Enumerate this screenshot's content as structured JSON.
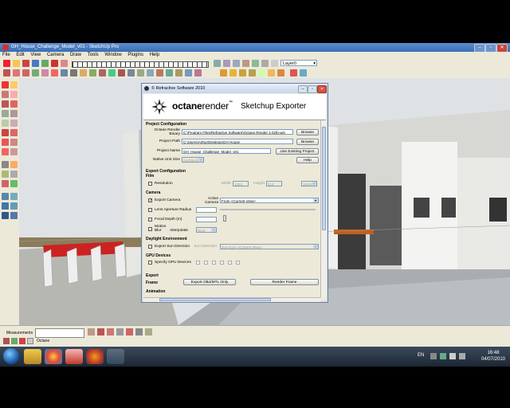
{
  "window": {
    "title": "GH_House_Challenge_Model_v01 - SketchUp Pro"
  },
  "menu": [
    "File",
    "Edit",
    "View",
    "Camera",
    "Draw",
    "Tools",
    "Window",
    "Plugins",
    "Help"
  ],
  "toolbar": {
    "layer_select": "Layer0"
  },
  "statusbar": {
    "measurements_label": "Measurements",
    "status_text": "Octane"
  },
  "taskbar": {
    "language": "EN",
    "time": "16:48",
    "date": "04/07/2010"
  },
  "dialog": {
    "title": "© Refractive Software 2010",
    "brand_bold": "octane",
    "brand_light": "render",
    "brand_tm": "™",
    "subtitle": "Sketchup Exporter",
    "project_config": {
      "heading": "Project Configuration",
      "binary_label": "Octane Render Binary",
      "binary_value": "C:\\Program Files\\Refractive Software\\Octane Render 2.02\\b-win",
      "browse1": "Browse",
      "path_label": "Project Path",
      "path_value": "C:\\Users\\Arthur\\Desktop\\GH House",
      "browse2": "Browse",
      "name_label": "Project Name",
      "name_value": "GH_House_Challenge_Model_v01",
      "use_existing": "Use Existing Project",
      "unit_label": "Native Unit Size",
      "unit_value": "(inch/inch)",
      "help": "Help"
    },
    "export_config": {
      "heading": "Export Configuration",
      "film_heading": "Film",
      "resolution_label": "Resolution",
      "width_label": "Width",
      "width_value": "1024",
      "height_label": "Height",
      "height_value": "512",
      "zoom_value": "100%"
    },
    "camera": {
      "heading": "Camera",
      "export_camera": "Export Camera",
      "active_camera_label": "Active Camera",
      "active_camera_value": "From <Current View>",
      "lens_aperture": "Lens Aperture Radius",
      "focal_depth": "Focal Depth (m)",
      "motion_blur": "Motion Blur",
      "interpolate_label": "Interpolate",
      "interpolate_value": "Next"
    },
    "daylight": {
      "heading": "Daylight Environment",
      "export_sun": "Export Sun Direction",
      "sun_label": "Sun Direction",
      "sun_value": "Sun from <Current View>"
    },
    "gpu": {
      "heading": "GPU Devices",
      "specify": "Specify GPU Devices"
    },
    "export": {
      "heading": "Export",
      "frame_label": "Frame",
      "export_obj": "Export OBJ/MTL Only",
      "render_frame": "Render Frame",
      "animation_heading": "Animation"
    }
  }
}
